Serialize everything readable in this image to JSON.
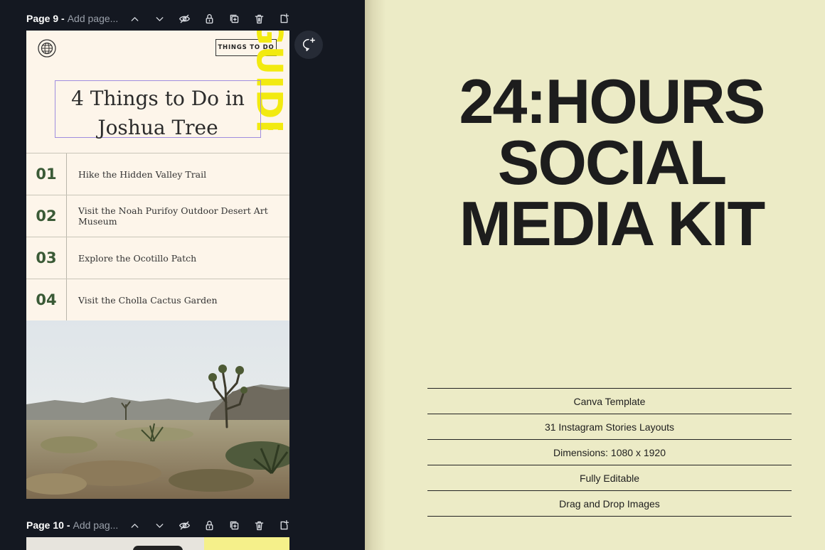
{
  "editor": {
    "page9": {
      "label": "Page 9 -",
      "placeholder": "Add page..."
    },
    "page10": {
      "label": "Page 10 -",
      "placeholder": "Add pag..."
    }
  },
  "design": {
    "button": "THINGS TO DO",
    "vertical_tag": "GUIDE",
    "title_line1": "4 Things to Do in",
    "title_line2": "Joshua Tree",
    "items": [
      {
        "num": "01",
        "text": "Hike the Hidden Valley Trail"
      },
      {
        "num": "02",
        "text": "Visit the Noah Purifoy Outdoor Desert Art Museum"
      },
      {
        "num": "03",
        "text": "Explore the Ocotillo Patch"
      },
      {
        "num": "04",
        "text": "Visit the Cholla Cactus Garden"
      }
    ]
  },
  "promo": {
    "line1": "24:HOURS",
    "line2": "SOCIAL",
    "line3": "MEDIA KIT",
    "features": [
      "Canva Template",
      "31 Instagram Stories Layouts",
      "Dimensions: 1080 x 1920",
      "Fully Editable",
      "Drag and Drop Images"
    ]
  },
  "colors": {
    "accent_yellow": "#f2ea10",
    "number_green": "#3a5a36",
    "selection_purple": "#9f8ddf",
    "editor_bg": "#141821"
  },
  "icons": [
    "chevron-up-icon",
    "chevron-down-icon",
    "hide-icon",
    "lock-icon",
    "duplicate-icon",
    "delete-icon",
    "add-page-icon",
    "add-comment-icon",
    "globe-icon"
  ]
}
